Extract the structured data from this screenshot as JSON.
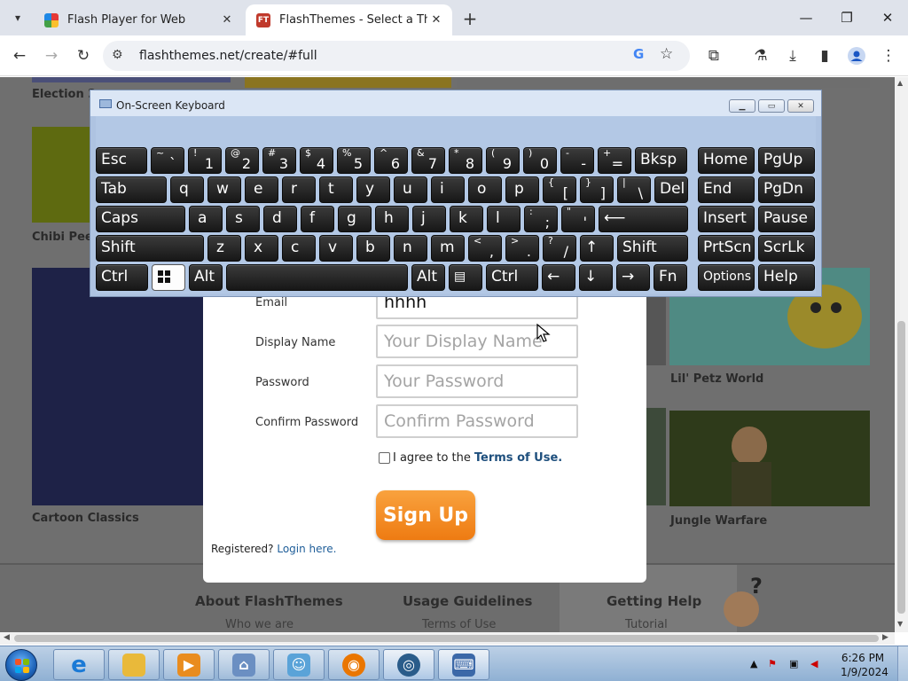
{
  "browser": {
    "tabs": [
      {
        "title": "Flash Player for Web",
        "active": false
      },
      {
        "title": "FlashThemes - Select a Theme!",
        "active": true
      }
    ],
    "url": "flashthemes.net/create/#full"
  },
  "page": {
    "themes": [
      {
        "label": "Election 2"
      },
      {
        "label": "Chibi Peep"
      },
      {
        "label": "Cartoon Classics"
      },
      {
        "label": "Lil' Petz World"
      },
      {
        "label": "Jungle Warfare"
      }
    ],
    "footer": {
      "about": "About FlashThemes",
      "about_sub": "Who we are",
      "usage": "Usage Guidelines",
      "usage_sub": "Terms of Use",
      "help": "Getting Help",
      "help_sub": "Tutorial"
    }
  },
  "signup": {
    "email_label": "Email",
    "email_value": "hhhh",
    "display_name_label": "Display Name",
    "display_name_placeholder": "Your Display Name",
    "password_label": "Password",
    "password_placeholder": "Your Password",
    "confirm_label": "Confirm Password",
    "confirm_placeholder": "Confirm Password",
    "agree_text": "I agree to the",
    "terms_link": "Terms of Use.",
    "button": "Sign Up",
    "registered_text": "Registered?",
    "login_link": "Login here."
  },
  "osk": {
    "title": "On-Screen Keyboard",
    "rows": [
      [
        {
          "main": "Esc"
        },
        {
          "sec": "~",
          "pri": "`"
        },
        {
          "sec": "!",
          "pri": "1"
        },
        {
          "sec": "@",
          "pri": "2"
        },
        {
          "sec": "#",
          "pri": "3"
        },
        {
          "sec": "$",
          "pri": "4"
        },
        {
          "sec": "%",
          "pri": "5"
        },
        {
          "sec": "^",
          "pri": "6"
        },
        {
          "sec": "&",
          "pri": "7"
        },
        {
          "sec": "*",
          "pri": "8"
        },
        {
          "sec": "(",
          "pri": "9"
        },
        {
          "sec": ")",
          "pri": "0"
        },
        {
          "sec": "-",
          "pri": "-"
        },
        {
          "sec": "+",
          "pri": "="
        },
        {
          "main": "Bksp"
        },
        {
          "main": "Home"
        },
        {
          "main": "PgUp"
        }
      ],
      [
        {
          "main": "Tab"
        },
        {
          "main": "q"
        },
        {
          "main": "w"
        },
        {
          "main": "e"
        },
        {
          "main": "r"
        },
        {
          "main": "t"
        },
        {
          "main": "y"
        },
        {
          "main": "u"
        },
        {
          "main": "i"
        },
        {
          "main": "o"
        },
        {
          "main": "p"
        },
        {
          "sec": "{",
          "pri": "["
        },
        {
          "sec": "}",
          "pri": "]"
        },
        {
          "sec": "|",
          "pri": "\\"
        },
        {
          "main": "Del"
        },
        {
          "main": "End"
        },
        {
          "main": "PgDn"
        }
      ],
      [
        {
          "main": "Caps"
        },
        {
          "main": "a"
        },
        {
          "main": "s"
        },
        {
          "main": "d"
        },
        {
          "main": "f"
        },
        {
          "main": "g"
        },
        {
          "main": "h"
        },
        {
          "main": "j"
        },
        {
          "main": "k"
        },
        {
          "main": "l"
        },
        {
          "sec": ":",
          "pri": ";"
        },
        {
          "sec": "\"",
          "pri": "'"
        },
        {
          "main": "⟵"
        },
        {
          "main": "Insert"
        },
        {
          "main": "Pause"
        }
      ],
      [
        {
          "main": "Shift"
        },
        {
          "main": "z"
        },
        {
          "main": "x"
        },
        {
          "main": "c"
        },
        {
          "main": "v"
        },
        {
          "main": "b"
        },
        {
          "main": "n"
        },
        {
          "main": "m"
        },
        {
          "sec": "<",
          "pri": ","
        },
        {
          "sec": ">",
          "pri": "."
        },
        {
          "sec": "?",
          "pri": "/"
        },
        {
          "main": "↑"
        },
        {
          "main": "Shift"
        },
        {
          "main": "PrtScn"
        },
        {
          "main": "ScrLk"
        }
      ],
      [
        {
          "main": "Ctrl"
        },
        {
          "main": "win-icon"
        },
        {
          "main": "Alt"
        },
        {
          "main": ""
        },
        {
          "main": "Alt"
        },
        {
          "main": "menu-icon"
        },
        {
          "main": "Ctrl"
        },
        {
          "main": "←"
        },
        {
          "main": "↓"
        },
        {
          "main": "→"
        },
        {
          "main": "Fn"
        },
        {
          "main": "Options"
        },
        {
          "main": "Help"
        }
      ]
    ]
  },
  "taskbar": {
    "time": "6:26 PM",
    "date": "1/9/2024",
    "items": [
      "ie-icon",
      "explorer-icon",
      "media-player-icon",
      "app-icon",
      "people-icon",
      "blender-icon",
      "steam-icon",
      "keyboard-icon"
    ]
  },
  "colors": {
    "signup_button": "#f28d22",
    "link": "#1e4f7d",
    "osk_bg": "#aec3e1"
  }
}
